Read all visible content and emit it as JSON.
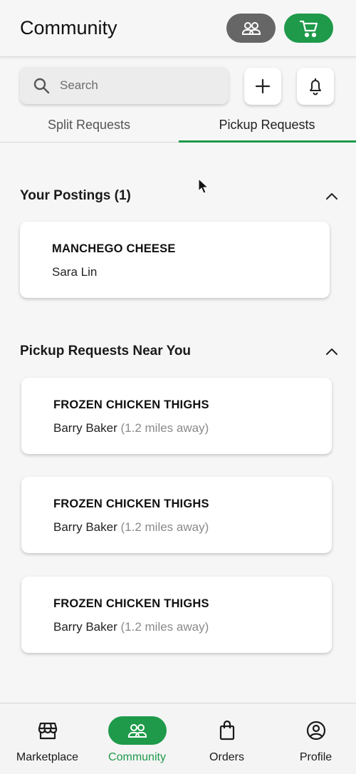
{
  "header": {
    "title": "Community",
    "community_icon": "people-icon",
    "cart_icon": "cart-icon"
  },
  "search": {
    "placeholder": "Search",
    "icon": "search-icon"
  },
  "actions": {
    "add_icon": "plus-icon",
    "bell_icon": "bell-icon"
  },
  "tabs": [
    {
      "label": "Split Requests",
      "active": false
    },
    {
      "label": "Pickup Requests",
      "active": true
    }
  ],
  "your_postings": {
    "title": "Your Postings (1)",
    "items": [
      {
        "product": "MANCHEGO CHEESE",
        "seller": "Sara Lin"
      }
    ]
  },
  "nearby": {
    "title": "Pickup Requests Near You",
    "items": [
      {
        "product": "FROZEN CHICKEN THIGHS",
        "seller": "Barry Baker",
        "distance": "(1.2 miles away)"
      },
      {
        "product": "FROZEN CHICKEN THIGHS",
        "seller": "Barry Baker",
        "distance": "(1.2 miles away)"
      },
      {
        "product": "FROZEN CHICKEN THIGHS",
        "seller": "Barry Baker",
        "distance": "(1.2 miles away)"
      }
    ]
  },
  "bottom_nav": [
    {
      "label": "Marketplace",
      "icon": "store-icon",
      "active": false
    },
    {
      "label": "Community",
      "icon": "people-icon",
      "active": true
    },
    {
      "label": "Orders",
      "icon": "bag-icon",
      "active": false
    },
    {
      "label": "Profile",
      "icon": "user-circle-icon",
      "active": false
    }
  ],
  "colors": {
    "accent": "#1e9a4a",
    "pill_gray": "#666666",
    "background": "#f6f6f6"
  }
}
